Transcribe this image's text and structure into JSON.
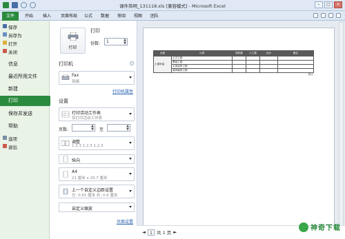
{
  "window": {
    "title": "课件简明_131118.xls [兼容模式] - Microsoft Excel",
    "controls": [
      "–",
      "□",
      "✕"
    ]
  },
  "ribbon": {
    "tabs": [
      "文件",
      "开始",
      "插入",
      "页面布局",
      "公式",
      "数据",
      "审阅",
      "视图",
      "团队"
    ]
  },
  "sidebar": {
    "items": [
      "保存",
      "另存为",
      "打开",
      "关闭",
      "信息",
      "最近所用文件",
      "新建",
      "打印",
      "保存并发送",
      "帮助",
      "选项",
      "退出"
    ]
  },
  "print": {
    "heading": "打印",
    "button_label": "打印",
    "copies_label": "份数:",
    "copies_value": "1"
  },
  "printer": {
    "heading": "打印机",
    "name": "Fax",
    "status": "就绪",
    "properties_link": "打印机属性"
  },
  "settings": {
    "heading": "设置",
    "scope": {
      "line1": "打印活动工作表",
      "line2": "仅打印活动工作表"
    },
    "pages_label": "页数:",
    "pages_to": "至",
    "pages_from_value": "",
    "pages_to_value": "",
    "collate": {
      "line1": "调整",
      "line2": "1,2,3    1,2,3    1,2,3"
    },
    "orientation": {
      "line1": "纵向"
    },
    "paper": {
      "line1": "A4",
      "line2": "21 厘米 x 29.7 厘米"
    },
    "margins": {
      "line1": "上一个自定义边距设置",
      "line2": "左: 0.61 厘米    右: 0.6 厘米"
    },
    "scaling": {
      "line1": "自定义缩放"
    },
    "page_setup_link": "页面设置"
  },
  "preview": {
    "table_headers": [
      "大类",
      "小类",
      "材料费",
      "人工费",
      "合计",
      "备注"
    ],
    "merged_label": "土建安装",
    "rows": [
      [
        "土方工程",
        "",
        "",
        "",
        ""
      ],
      [
        "基础工程",
        "",
        "",
        "",
        ""
      ],
      [
        "主体结构工程",
        "",
        "",
        "",
        ""
      ],
      [
        "装饰装修工程",
        "",
        "",
        "",
        ""
      ]
    ],
    "total_label": "总计"
  },
  "pager": {
    "current_page": "1",
    "total_text": "共 1 页"
  },
  "watermark": {
    "text": "神奇下载"
  }
}
